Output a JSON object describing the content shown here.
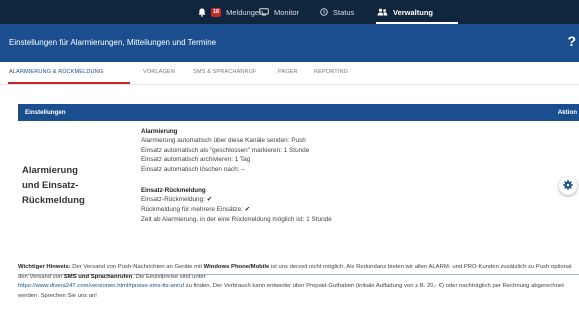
{
  "nav": {
    "items": [
      {
        "label": "Meldungen",
        "badge": "18",
        "icon": "bell-icon"
      },
      {
        "label": "Monitor",
        "icon": "monitor-icon"
      },
      {
        "label": "Status",
        "icon": "clock-icon"
      },
      {
        "label": "Verwaltung",
        "icon": "users-icon",
        "active": true
      }
    ]
  },
  "header": {
    "title": "Einstellungen für Alarmierungen, Mitteilungen und Termine",
    "help": "?"
  },
  "tabs": [
    {
      "label": "ALARMIERUNG & RÜCKMELDUNG",
      "active": true
    },
    {
      "label": "VORLAGEN"
    },
    {
      "label": "SMS & SPRACHANRUF"
    },
    {
      "label": "PAGER"
    },
    {
      "label": "REPORTING"
    }
  ],
  "table": {
    "head_left": "Einstellungen",
    "head_right": "Aktion",
    "row": {
      "title_lines": [
        "Alarmierung",
        "und Einsatz-",
        "Rückmeldung"
      ],
      "section1": {
        "heading": "Alarmierung",
        "lines": [
          "Alarmierung automatisch über diese Kanäle senden: Push",
          "Einsatz automatisch als \"geschlossen\" markieren: 1 Stunde",
          "Einsatz automatisch archivieren: 1 Tag",
          "Einsatz automatisch löschen nach: –"
        ]
      },
      "section2": {
        "heading": "Einsatz-Rückmeldung",
        "line1": "Einsatz-Rückmeldung: ",
        "line2": "Rückmeldung für mehrere Einsätze: ",
        "check": "✔",
        "line3": "Zeit ab Alarmierung, in der eine Rückmeldung möglich ist: 1 Stunde"
      }
    }
  },
  "notice": {
    "label": "Wichtiger Hinweis:",
    "text1": " Der Versand von Push-Nachrichten an Geräte mit ",
    "bold1": "Windows Phone/Mobile",
    "text2": " ist uns derzeit nicht möglich. Als Redundanz bieten wir allen ALARM- und PRO-Kunden zusätzlich zu Push optional den Versand von ",
    "bold2": "SMS und Sprachanrufen",
    "text3": ". Die Einzelpreise sind unter ",
    "link": "https://www.divera247.com/versionen.html#preise-sms-tts-anruf",
    "text4": " zu finden. Der Verbrauch kann entweder über Prepaid-Guthaben (initiale Aufladung von z.B. 20,- €) oder nachträglich per Rechnung abgerechnet werden. Sprechen Sie uns an!"
  },
  "colors": {
    "nav_bg": "#10263d",
    "primary": "#1a4e8f",
    "accent_red": "#c62828"
  }
}
